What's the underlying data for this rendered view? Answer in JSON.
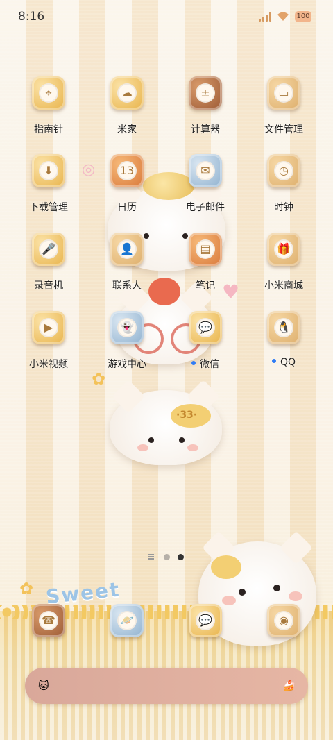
{
  "status_bar": {
    "time": "8:16",
    "battery": "100",
    "signal_icon": "signal-icon",
    "wifi_icon": "wifi-icon"
  },
  "apps": [
    {
      "label": "指南针",
      "icon": "compass-icon",
      "glyph": "⌖"
    },
    {
      "label": "米家",
      "icon": "mijia-icon",
      "glyph": "☁"
    },
    {
      "label": "计算器",
      "icon": "calculator-icon",
      "glyph": "±"
    },
    {
      "label": "文件管理",
      "icon": "folder-icon",
      "glyph": "▭"
    },
    {
      "label": "下载管理",
      "icon": "download-icon",
      "glyph": "⬇"
    },
    {
      "label": "日历",
      "icon": "calendar-icon",
      "glyph": "13"
    },
    {
      "label": "电子邮件",
      "icon": "mail-icon",
      "glyph": "✉"
    },
    {
      "label": "时钟",
      "icon": "clock-icon",
      "glyph": "◷"
    },
    {
      "label": "录音机",
      "icon": "microphone-icon",
      "glyph": "🎤"
    },
    {
      "label": "联系人",
      "icon": "contacts-icon",
      "glyph": "👤"
    },
    {
      "label": "笔记",
      "icon": "notes-icon",
      "glyph": "▤"
    },
    {
      "label": "小米商城",
      "icon": "gift-icon",
      "glyph": "🎁"
    },
    {
      "label": "小米视频",
      "icon": "video-play-icon",
      "glyph": "▶"
    },
    {
      "label": "游戏中心",
      "icon": "game-ghost-icon",
      "glyph": "👻"
    },
    {
      "label": "微信",
      "icon": "wechat-icon",
      "glyph": "💬",
      "new_badge": true
    },
    {
      "label": "QQ",
      "icon": "qq-penguin-icon",
      "glyph": "🐧",
      "new_badge": true
    }
  ],
  "dock": [
    {
      "icon": "phone-icon",
      "glyph": "☎"
    },
    {
      "icon": "browser-planet-icon",
      "glyph": "🪐"
    },
    {
      "icon": "messages-icon",
      "glyph": "💬"
    },
    {
      "icon": "camera-icon",
      "glyph": "◉"
    }
  ],
  "decor": {
    "sweet_text": "Sweet",
    "fish_label": "·33·"
  },
  "pager": {
    "active_index": 1,
    "count": 2
  },
  "search": {
    "left_icon": "cat-face-icon",
    "right_icon": "cake-icon",
    "left_glyph": "🐱",
    "right_glyph": "🍰"
  },
  "colors": {
    "accent_blue": "#2f7cf5",
    "search_bar": "#deaa9c"
  }
}
